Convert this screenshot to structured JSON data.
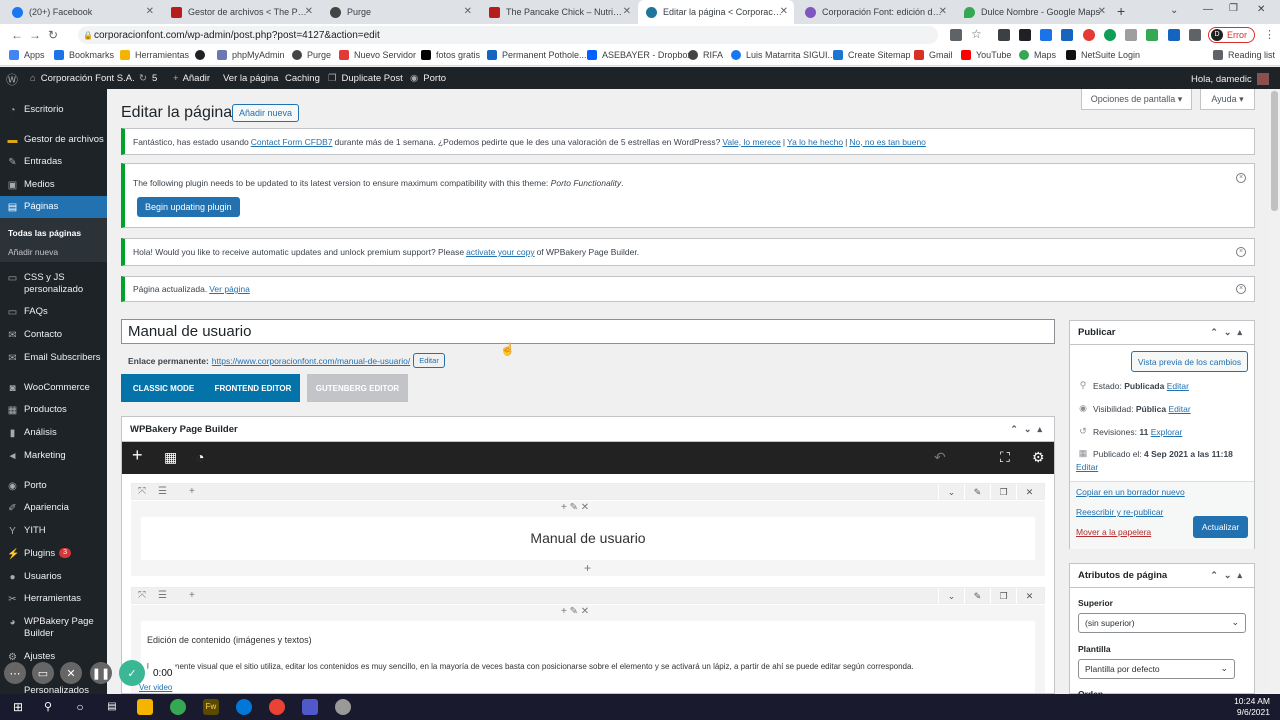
{
  "browser": {
    "tabs": [
      {
        "title": "(20+) Facebook",
        "color": "#1877f2"
      },
      {
        "title": "Gestor de archivos < The Pancake",
        "color": "#b71c1c"
      },
      {
        "title": "Purge",
        "color": "#444444"
      },
      {
        "title": "The Pancake Chick – Nutricionist",
        "color": "#b71c1c"
      },
      {
        "title": "Editar la página < Corporación F",
        "color": "#21759b"
      },
      {
        "title": "Corporación Font: edición de co",
        "color": "#7e57c2"
      },
      {
        "title": "Dulce Nombre - Google Maps",
        "color": "#34a853"
      }
    ],
    "new_tab": "+",
    "url": "corporacionfont.com/wp-admin/post.php?post=4127&action=edit",
    "error_label": "Error",
    "bookmarks": [
      {
        "label": "Apps",
        "color": "#4285f4"
      },
      {
        "label": "Bookmarks",
        "color": "#1a73e8"
      },
      {
        "label": "Herramientas",
        "color": "#f4b400"
      },
      {
        "label": "",
        "color": "#202124"
      },
      {
        "label": "phpMyAdmin",
        "color": "#6c78af"
      },
      {
        "label": "Purge",
        "color": "#444444"
      },
      {
        "label": "Nuevo Servidor",
        "color": "#e53935"
      },
      {
        "label": "fotos gratis",
        "color": "#000000"
      },
      {
        "label": "Permanent Pothole...",
        "color": "#1565c0"
      },
      {
        "label": "ASEBAYER - Dropbox",
        "color": "#0061ff"
      },
      {
        "label": "RIFA",
        "color": "#444444"
      },
      {
        "label": "Luis Matarrita SIGUI...",
        "color": "#1877f2"
      },
      {
        "label": "Create Sitemap",
        "color": "#1976d2"
      },
      {
        "label": "Gmail",
        "color": "#d93025"
      },
      {
        "label": "YouTube",
        "color": "#ff0000"
      },
      {
        "label": "Maps",
        "color": "#34a853"
      },
      {
        "label": "NetSuite Login",
        "color": "#111111"
      },
      {
        "label": "Reading list",
        "color": "#5f6368"
      }
    ]
  },
  "adminbar": {
    "site": "Corporación Font S.A.",
    "updates": "5",
    "add": "Añadir",
    "view": "Ver la página",
    "caching": "Caching",
    "duplicate": "Duplicate Post",
    "porto": "Porto",
    "greeting": "Hola, damedic"
  },
  "sidebar": {
    "items": [
      {
        "label": "Escritorio",
        "icon": "dashboard-icon"
      },
      {
        "label": "Gestor de archivos",
        "icon": "folder-icon"
      },
      {
        "label": "Entradas",
        "icon": "pin-icon"
      },
      {
        "label": "Medios",
        "icon": "media-icon"
      },
      {
        "label": "Páginas",
        "icon": "pages-icon"
      },
      {
        "label": "CSS y JS personalizado",
        "icon": "code-icon"
      },
      {
        "label": "FAQs",
        "icon": "faq-icon"
      },
      {
        "label": "Contacto",
        "icon": "mail-icon"
      },
      {
        "label": "Email Subscribers",
        "icon": "envelope-icon"
      },
      {
        "label": "WooCommerce",
        "icon": "woo-icon"
      },
      {
        "label": "Productos",
        "icon": "box-icon"
      },
      {
        "label": "Análisis",
        "icon": "chart-icon"
      },
      {
        "label": "Marketing",
        "icon": "megaphone-icon"
      },
      {
        "label": "Porto",
        "icon": "porto-icon"
      },
      {
        "label": "Apariencia",
        "icon": "brush-icon"
      },
      {
        "label": "YITH",
        "icon": "yith-icon"
      },
      {
        "label": "Plugins",
        "icon": "plug-icon",
        "badge": "3"
      },
      {
        "label": "Usuarios",
        "icon": "user-icon"
      },
      {
        "label": "Herramientas",
        "icon": "wrench-icon"
      },
      {
        "label": "WPBakery Page Builder",
        "icon": "wpbakery-icon"
      },
      {
        "label": "Ajustes",
        "icon": "settings-icon"
      },
      {
        "label": "Personalizados",
        "icon": "custom-icon"
      }
    ],
    "submenu": [
      "Todas las páginas",
      "Añadir nueva"
    ]
  },
  "screen_options": "Opciones de pantalla ▾",
  "help": "Ayuda ▾",
  "page_title": "Editar la página",
  "add_new": "Añadir nueva",
  "notices": {
    "cf7_pre": "Fantástico, has estado usando",
    "cf7_link": "Contact Form CFDB7",
    "cf7_mid": "durante más de 1 semana. ¿Podemos pedirte que le des una valoración de 5 estrellas en WordPress?",
    "cf7_a1": "Vale, lo merece",
    "cf7_a2": "Ya lo he hecho",
    "cf7_a3": "No, no es tan bueno",
    "plugin_text": "The following plugin needs to be updated to its latest version to ensure maximum compatibility with this theme:",
    "plugin_name": "Porto Functionality",
    "plugin_button": "Begin updating plugin",
    "wpb_pre": "Hola! Would you like to receive automatic updates and unlock premium support? Please",
    "wpb_link": "activate your copy",
    "wpb_post": "of WPBakery Page Builder.",
    "updated_text": "Página actualizada.",
    "updated_link": "Ver página"
  },
  "editor": {
    "title": "Manual de usuario",
    "permalink_label": "Enlace permanente:",
    "permalink_url": "https://www.corporacionfont.com/manual-de-usuario/",
    "permalink_edit": "Editar",
    "classic_mode": "CLASSIC MODE",
    "frontend_editor": "FRONTEND EDITOR",
    "gutenberg_editor": "GUTENBERG EDITOR"
  },
  "wpbakery": {
    "title": "WPBakery Page Builder",
    "row1_heading": "Manual de usuario",
    "row2_heading": "Edición de contenido (imágenes y textos)",
    "row2_text": "l componente visual que el sitio utiliza, editar los contenidos es muy sencillo, en la mayoría de veces basta con posicionarse sobre el elemento y se activará un lápiz, a partir de ahí se puede editar según corresponda.",
    "row2_link": "Ver video"
  },
  "publish": {
    "title": "Publicar",
    "preview": "Vista previa de los cambios",
    "status_label": "Estado:",
    "status_value": "Publicada",
    "visibility_label": "Visibilidad:",
    "visibility_value": "Pública",
    "revisions_label": "Revisiones:",
    "revisions_value": "11",
    "revisions_link": "Explorar",
    "published_label": "Publicado el:",
    "published_value": "4 Sep 2021 a las 11:18",
    "edit": "Editar",
    "copy_draft": "Copiar en un borrador nuevo",
    "rewrite": "Reescribir y re-publicar",
    "trash": "Mover a la papelera",
    "update": "Actualizar"
  },
  "attributes": {
    "title": "Atributos de página",
    "parent_label": "Superior",
    "parent_value": "(sin superior)",
    "template_label": "Plantilla",
    "template_value": "Plantilla por defecto",
    "order_label": "Orden"
  },
  "recorder": {
    "timer": "0:00"
  },
  "taskbar": {
    "time": "10:24 AM",
    "date": "9/6/2021"
  }
}
